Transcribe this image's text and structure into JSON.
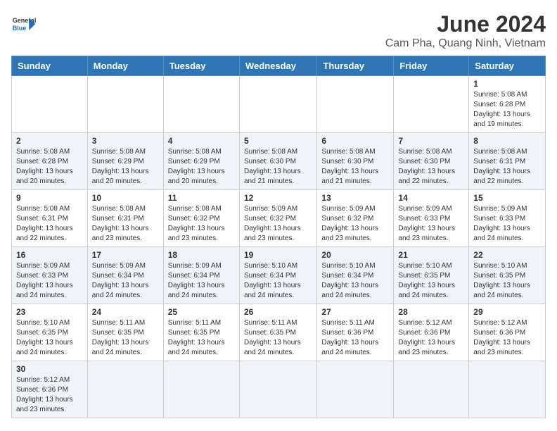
{
  "header": {
    "logo_general": "General",
    "logo_blue": "Blue",
    "month_title": "June 2024",
    "location": "Cam Pha, Quang Ninh, Vietnam"
  },
  "weekdays": [
    "Sunday",
    "Monday",
    "Tuesday",
    "Wednesday",
    "Thursday",
    "Friday",
    "Saturday"
  ],
  "weeks": [
    [
      {
        "day": "",
        "info": ""
      },
      {
        "day": "",
        "info": ""
      },
      {
        "day": "",
        "info": ""
      },
      {
        "day": "",
        "info": ""
      },
      {
        "day": "",
        "info": ""
      },
      {
        "day": "",
        "info": ""
      },
      {
        "day": "1",
        "info": "Sunrise: 5:08 AM\nSunset: 6:28 PM\nDaylight: 13 hours\nand 19 minutes."
      }
    ],
    [
      {
        "day": "2",
        "info": "Sunrise: 5:08 AM\nSunset: 6:28 PM\nDaylight: 13 hours\nand 20 minutes."
      },
      {
        "day": "3",
        "info": "Sunrise: 5:08 AM\nSunset: 6:29 PM\nDaylight: 13 hours\nand 20 minutes."
      },
      {
        "day": "4",
        "info": "Sunrise: 5:08 AM\nSunset: 6:29 PM\nDaylight: 13 hours\nand 20 minutes."
      },
      {
        "day": "5",
        "info": "Sunrise: 5:08 AM\nSunset: 6:30 PM\nDaylight: 13 hours\nand 21 minutes."
      },
      {
        "day": "6",
        "info": "Sunrise: 5:08 AM\nSunset: 6:30 PM\nDaylight: 13 hours\nand 21 minutes."
      },
      {
        "day": "7",
        "info": "Sunrise: 5:08 AM\nSunset: 6:30 PM\nDaylight: 13 hours\nand 22 minutes."
      },
      {
        "day": "8",
        "info": "Sunrise: 5:08 AM\nSunset: 6:31 PM\nDaylight: 13 hours\nand 22 minutes."
      }
    ],
    [
      {
        "day": "9",
        "info": "Sunrise: 5:08 AM\nSunset: 6:31 PM\nDaylight: 13 hours\nand 22 minutes."
      },
      {
        "day": "10",
        "info": "Sunrise: 5:08 AM\nSunset: 6:31 PM\nDaylight: 13 hours\nand 23 minutes."
      },
      {
        "day": "11",
        "info": "Sunrise: 5:08 AM\nSunset: 6:32 PM\nDaylight: 13 hours\nand 23 minutes."
      },
      {
        "day": "12",
        "info": "Sunrise: 5:09 AM\nSunset: 6:32 PM\nDaylight: 13 hours\nand 23 minutes."
      },
      {
        "day": "13",
        "info": "Sunrise: 5:09 AM\nSunset: 6:32 PM\nDaylight: 13 hours\nand 23 minutes."
      },
      {
        "day": "14",
        "info": "Sunrise: 5:09 AM\nSunset: 6:33 PM\nDaylight: 13 hours\nand 23 minutes."
      },
      {
        "day": "15",
        "info": "Sunrise: 5:09 AM\nSunset: 6:33 PM\nDaylight: 13 hours\nand 24 minutes."
      }
    ],
    [
      {
        "day": "16",
        "info": "Sunrise: 5:09 AM\nSunset: 6:33 PM\nDaylight: 13 hours\nand 24 minutes."
      },
      {
        "day": "17",
        "info": "Sunrise: 5:09 AM\nSunset: 6:34 PM\nDaylight: 13 hours\nand 24 minutes."
      },
      {
        "day": "18",
        "info": "Sunrise: 5:09 AM\nSunset: 6:34 PM\nDaylight: 13 hours\nand 24 minutes."
      },
      {
        "day": "19",
        "info": "Sunrise: 5:10 AM\nSunset: 6:34 PM\nDaylight: 13 hours\nand 24 minutes."
      },
      {
        "day": "20",
        "info": "Sunrise: 5:10 AM\nSunset: 6:34 PM\nDaylight: 13 hours\nand 24 minutes."
      },
      {
        "day": "21",
        "info": "Sunrise: 5:10 AM\nSunset: 6:35 PM\nDaylight: 13 hours\nand 24 minutes."
      },
      {
        "day": "22",
        "info": "Sunrise: 5:10 AM\nSunset: 6:35 PM\nDaylight: 13 hours\nand 24 minutes."
      }
    ],
    [
      {
        "day": "23",
        "info": "Sunrise: 5:10 AM\nSunset: 6:35 PM\nDaylight: 13 hours\nand 24 minutes."
      },
      {
        "day": "24",
        "info": "Sunrise: 5:11 AM\nSunset: 6:35 PM\nDaylight: 13 hours\nand 24 minutes."
      },
      {
        "day": "25",
        "info": "Sunrise: 5:11 AM\nSunset: 6:35 PM\nDaylight: 13 hours\nand 24 minutes."
      },
      {
        "day": "26",
        "info": "Sunrise: 5:11 AM\nSunset: 6:35 PM\nDaylight: 13 hours\nand 24 minutes."
      },
      {
        "day": "27",
        "info": "Sunrise: 5:11 AM\nSunset: 6:36 PM\nDaylight: 13 hours\nand 24 minutes."
      },
      {
        "day": "28",
        "info": "Sunrise: 5:12 AM\nSunset: 6:36 PM\nDaylight: 13 hours\nand 23 minutes."
      },
      {
        "day": "29",
        "info": "Sunrise: 5:12 AM\nSunset: 6:36 PM\nDaylight: 13 hours\nand 23 minutes."
      }
    ],
    [
      {
        "day": "30",
        "info": "Sunrise: 5:12 AM\nSunset: 6:36 PM\nDaylight: 13 hours\nand 23 minutes."
      },
      {
        "day": "",
        "info": ""
      },
      {
        "day": "",
        "info": ""
      },
      {
        "day": "",
        "info": ""
      },
      {
        "day": "",
        "info": ""
      },
      {
        "day": "",
        "info": ""
      },
      {
        "day": "",
        "info": ""
      }
    ]
  ]
}
